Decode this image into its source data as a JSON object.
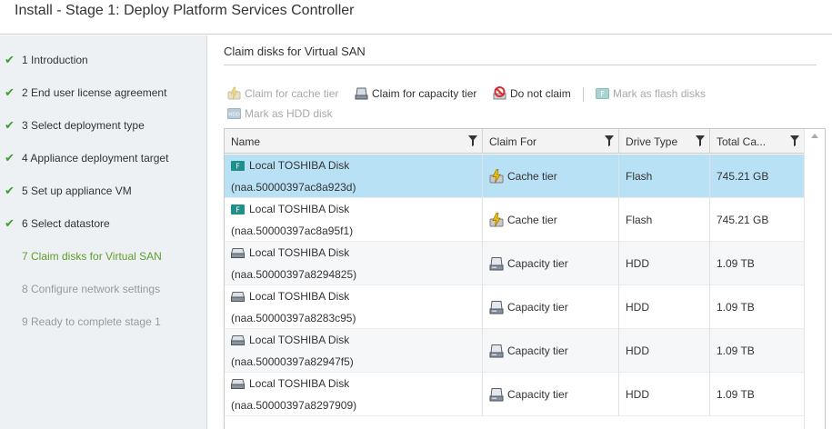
{
  "window": {
    "title": "Install - Stage 1: Deploy Platform Services Controller"
  },
  "steps": [
    {
      "label": "1 Introduction",
      "state": "done"
    },
    {
      "label": "2 End user license agreement",
      "state": "done"
    },
    {
      "label": "3 Select deployment type",
      "state": "done"
    },
    {
      "label": "4 Appliance deployment target",
      "state": "done"
    },
    {
      "label": "5 Set up appliance VM",
      "state": "done"
    },
    {
      "label": "6 Select datastore",
      "state": "done"
    },
    {
      "label": "7 Claim disks for Virtual SAN",
      "state": "active"
    },
    {
      "label": "8 Configure network settings",
      "state": "future"
    },
    {
      "label": "9 Ready to complete stage 1",
      "state": "future"
    }
  ],
  "main": {
    "title": "Claim disks for Virtual SAN",
    "toolbar": {
      "claim_cache": "Claim for cache tier",
      "claim_capacity": "Claim for capacity tier",
      "do_not_claim": "Do not claim",
      "mark_flash": "Mark as flash disks",
      "mark_hdd": "Mark as HDD disk"
    },
    "columns": {
      "name": "Name",
      "claim_for": "Claim For",
      "drive_type": "Drive Type",
      "total_capacity": "Total Ca..."
    },
    "rows": [
      {
        "name": "Local TOSHIBA Disk",
        "id": "(naa.50000397ac8a923d)",
        "claim_for": "Cache tier",
        "drive_type": "Flash",
        "capacity": "745.21 GB",
        "kind": "flash",
        "selected": true
      },
      {
        "name": "Local TOSHIBA Disk",
        "id": "(naa.50000397ac8a95f1)",
        "claim_for": "Cache tier",
        "drive_type": "Flash",
        "capacity": "745.21 GB",
        "kind": "flash",
        "selected": false
      },
      {
        "name": "Local TOSHIBA Disk",
        "id": "(naa.50000397a8294825)",
        "claim_for": "Capacity tier",
        "drive_type": "HDD",
        "capacity": "1.09 TB",
        "kind": "hdd",
        "selected": false
      },
      {
        "name": "Local TOSHIBA Disk",
        "id": "(naa.50000397a8283c95)",
        "claim_for": "Capacity tier",
        "drive_type": "HDD",
        "capacity": "1.09 TB",
        "kind": "hdd",
        "selected": false
      },
      {
        "name": "Local TOSHIBA Disk",
        "id": "(naa.50000397a82947f5)",
        "claim_for": "Capacity tier",
        "drive_type": "HDD",
        "capacity": "1.09 TB",
        "kind": "hdd",
        "selected": false
      },
      {
        "name": "Local TOSHIBA Disk",
        "id": "(naa.50000397a8297909)",
        "claim_for": "Capacity tier",
        "drive_type": "HDD",
        "capacity": "1.09 TB",
        "kind": "hdd",
        "selected": false
      }
    ]
  },
  "colors": {
    "check": "#3f9d2f",
    "active_step": "#5e9e2a",
    "selected_row": "#b9e1f5",
    "flash_badge": "#1f8f8a"
  },
  "icons": {
    "step_done": "checkmark-icon",
    "flash_disk": "flash-disk-icon",
    "hdd_disk": "hdd-disk-icon",
    "cache_tier": "cache-tier-lightning-icon",
    "capacity_tier": "capacity-tier-disk-icon",
    "do_not_claim": "no-entry-icon",
    "filter": "filter-funnel-icon"
  }
}
